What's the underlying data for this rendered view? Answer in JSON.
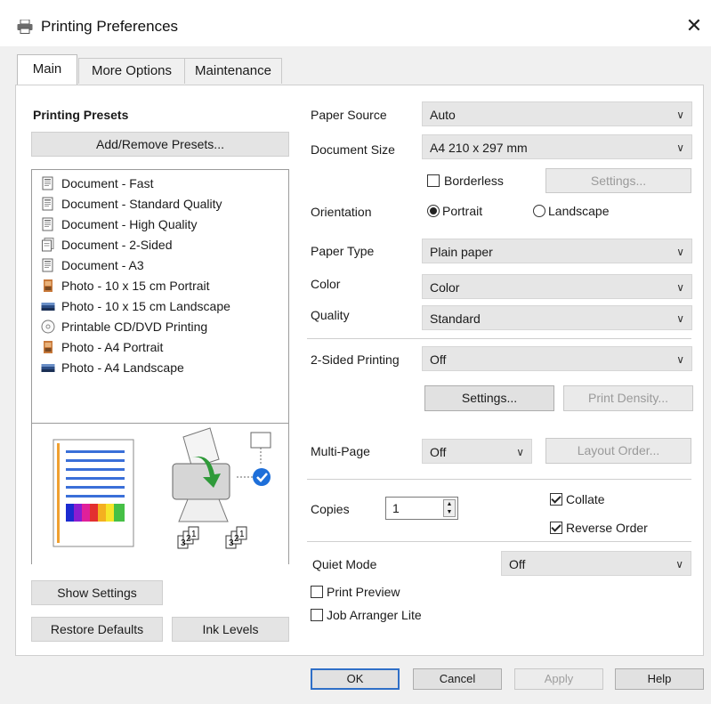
{
  "window": {
    "title": "Printing Preferences",
    "close_glyph": "✕"
  },
  "tabs": [
    {
      "label": "Main"
    },
    {
      "label": "More Options"
    },
    {
      "label": "Maintenance"
    }
  ],
  "presets": {
    "title": "Printing Presets",
    "add_remove_label": "Add/Remove Presets...",
    "items": [
      {
        "label": "Document - Fast",
        "icon": "document-icon"
      },
      {
        "label": "Document - Standard Quality",
        "icon": "document-icon"
      },
      {
        "label": "Document - High Quality",
        "icon": "document-icon"
      },
      {
        "label": "Document - 2-Sided",
        "icon": "two-sided-document-icon"
      },
      {
        "label": "Document - A3",
        "icon": "document-icon"
      },
      {
        "label": "Photo - 10 x 15 cm Portrait",
        "icon": "photo-portrait-icon"
      },
      {
        "label": "Photo - 10 x 15 cm Landscape",
        "icon": "photo-landscape-icon"
      },
      {
        "label": "Printable CD/DVD Printing",
        "icon": "disc-icon"
      },
      {
        "label": "Photo - A4 Portrait",
        "icon": "photo-portrait-icon"
      },
      {
        "label": "Photo - A4 Landscape",
        "icon": "photo-landscape-icon"
      }
    ],
    "preview_page_numbers": [
      "1",
      "2",
      "3"
    ]
  },
  "left_buttons": {
    "show_settings": "Show Settings",
    "restore_defaults": "Restore Defaults",
    "ink_levels": "Ink Levels"
  },
  "settings": {
    "paper_source": {
      "label": "Paper Source",
      "value": "Auto"
    },
    "document_size": {
      "label": "Document Size",
      "value": "A4 210 x 297 mm"
    },
    "borderless": {
      "label": "Borderless",
      "checked": false
    },
    "borderless_settings": "Settings...",
    "orientation": {
      "label": "Orientation",
      "portrait": "Portrait",
      "landscape": "Landscape",
      "selected": "Portrait"
    },
    "paper_type": {
      "label": "Paper Type",
      "value": "Plain paper"
    },
    "color": {
      "label": "Color",
      "value": "Color"
    },
    "quality": {
      "label": "Quality",
      "value": "Standard"
    },
    "two_sided": {
      "label": "2-Sided Printing",
      "value": "Off"
    },
    "two_sided_settings": "Settings...",
    "print_density": "Print Density...",
    "multi_page": {
      "label": "Multi-Page",
      "value": "Off"
    },
    "layout_order": "Layout Order...",
    "copies": {
      "label": "Copies",
      "value": "1"
    },
    "collate": {
      "label": "Collate",
      "checked": true
    },
    "reverse_order": {
      "label": "Reverse Order",
      "checked": true
    },
    "quiet_mode": {
      "label": "Quiet Mode",
      "value": "Off"
    },
    "print_preview": {
      "label": "Print Preview",
      "checked": false
    },
    "job_arranger": {
      "label": "Job Arranger Lite",
      "checked": false
    }
  },
  "dialog_buttons": {
    "ok": "OK",
    "cancel": "Cancel",
    "apply": "Apply",
    "help": "Help"
  },
  "colors": {
    "accent": "#2f6fc7",
    "check_badge": "#1e6fd9",
    "preview_lines": "#3a6fd8",
    "preview_border": "#f0a030"
  }
}
